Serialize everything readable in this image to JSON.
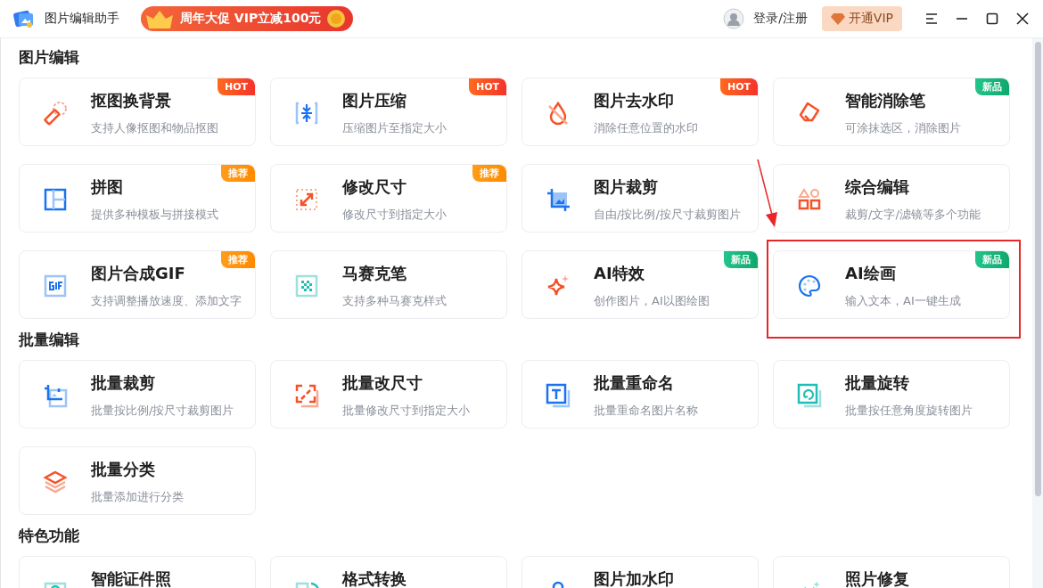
{
  "window": {
    "title": "图片编辑助手",
    "promo": "周年大促 VIP立减100元",
    "login": "登录/注册",
    "vip_button": "开通VIP"
  },
  "sections": [
    {
      "title": "图片编辑",
      "cards": [
        {
          "title": "抠图换背景",
          "desc": "支持人像抠图和物品抠图",
          "kind": "cutout",
          "badge": {
            "text": "HOT",
            "kind": "hot"
          }
        },
        {
          "title": "图片压缩",
          "desc": "压缩图片至指定大小",
          "kind": "compress",
          "badge": {
            "text": "HOT",
            "kind": "hot"
          }
        },
        {
          "title": "图片去水印",
          "desc": "消除任意位置的水印",
          "kind": "drop",
          "badge": {
            "text": "HOT",
            "kind": "hot"
          }
        },
        {
          "title": "智能消除笔",
          "desc": "可涂抹选区，消除图片",
          "kind": "eraser",
          "badge": {
            "text": "新品",
            "kind": "new"
          }
        },
        {
          "title": "拼图",
          "desc": "提供多种模板与拼接模式",
          "kind": "collage",
          "badge": {
            "text": "推荐",
            "kind": "recommend"
          }
        },
        {
          "title": "修改尺寸",
          "desc": "修改尺寸到指定大小",
          "kind": "resize",
          "badge": {
            "text": "推荐",
            "kind": "recommend"
          }
        },
        {
          "title": "图片裁剪",
          "desc": "自由/按比例/按尺寸裁剪图片",
          "kind": "crop"
        },
        {
          "title": "综合编辑",
          "desc": "裁剪/文字/滤镜等多个功能",
          "kind": "shapes"
        },
        {
          "title": "图片合成GIF",
          "desc": "支持调整播放速度、添加文字",
          "kind": "gif",
          "badge": {
            "text": "推荐",
            "kind": "recommend"
          }
        },
        {
          "title": "马赛克笔",
          "desc": "支持多种马赛克样式",
          "kind": "mosaic"
        },
        {
          "title": "AI特效",
          "desc": "创作图片，AI以图绘图",
          "kind": "sparkle",
          "badge": {
            "text": "新品",
            "kind": "new"
          }
        },
        {
          "title": "AI绘画",
          "desc": "输入文本，AI一键生成",
          "kind": "palette",
          "badge": {
            "text": "新品",
            "kind": "new"
          },
          "highlighted": true
        }
      ]
    },
    {
      "title": "批量编辑",
      "cards": [
        {
          "title": "批量裁剪",
          "desc": "批量按比例/按尺寸裁剪图片",
          "kind": "batch-crop"
        },
        {
          "title": "批量改尺寸",
          "desc": "批量修改尺寸到指定大小",
          "kind": "batch-resize"
        },
        {
          "title": "批量重命名",
          "desc": "批量重命名图片名称",
          "kind": "batch-rename"
        },
        {
          "title": "批量旋转",
          "desc": "批量按任意角度旋转图片",
          "kind": "batch-rotate"
        },
        {
          "title": "批量分类",
          "desc": "批量添加进行分类",
          "kind": "layers"
        }
      ]
    },
    {
      "title": "特色功能",
      "cards": [
        {
          "title": "智能证件照",
          "kind": "idphoto"
        },
        {
          "title": "格式转换",
          "kind": "convert"
        },
        {
          "title": "图片加水印",
          "kind": "pin"
        },
        {
          "title": "照片修复",
          "kind": "repair"
        }
      ]
    }
  ]
}
